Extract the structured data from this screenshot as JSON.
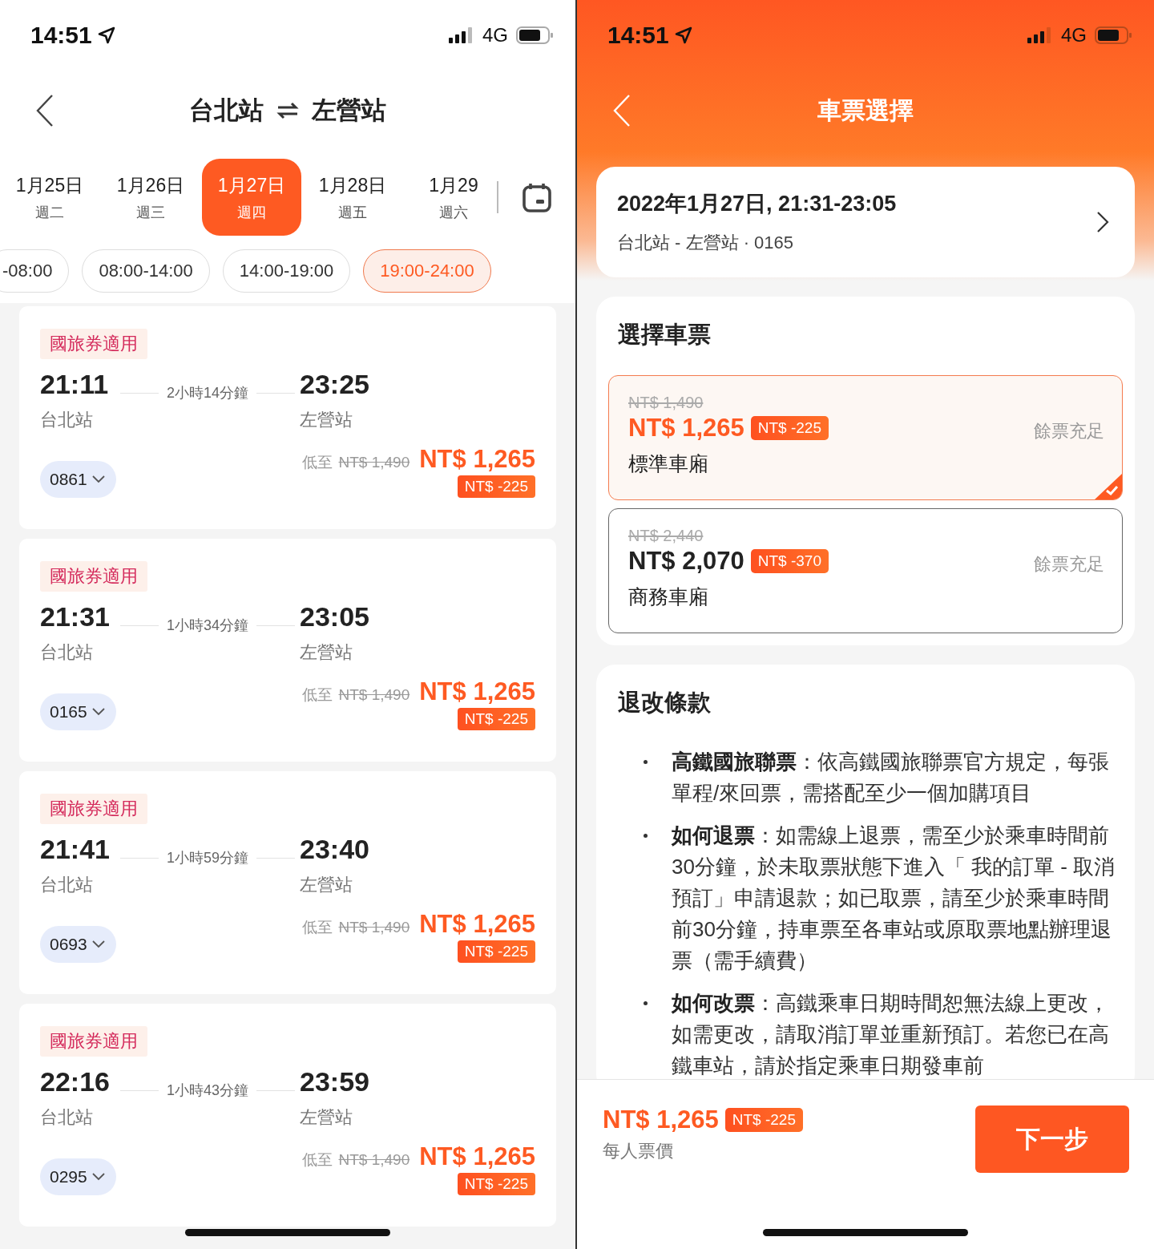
{
  "left": {
    "status": {
      "time": "14:51",
      "network": "4G"
    },
    "header": {
      "from": "台北站",
      "to": "左營站"
    },
    "dates": [
      {
        "date": "1月25日",
        "weekday": "週二",
        "selected": false
      },
      {
        "date": "1月26日",
        "weekday": "週三",
        "selected": false
      },
      {
        "date": "1月27日",
        "weekday": "週四",
        "selected": true
      },
      {
        "date": "1月28日",
        "weekday": "週五",
        "selected": false
      },
      {
        "date": "1月29",
        "weekday": "週六",
        "selected": false
      }
    ],
    "time_filters": [
      {
        "label": "-08:00",
        "selected": false
      },
      {
        "label": "08:00-14:00",
        "selected": false
      },
      {
        "label": "14:00-19:00",
        "selected": false
      },
      {
        "label": "19:00-24:00",
        "selected": true
      }
    ],
    "trains": [
      {
        "tag": "國旅券適用",
        "departure": "21:11",
        "duration": "2小時14分鐘",
        "arrival": "23:25",
        "from": "台北站",
        "to": "左營站",
        "number": "0861",
        "low_label": "低至",
        "original": "NT$ 1,490",
        "price": "NT$ 1,265",
        "discount": "NT$ -225"
      },
      {
        "tag": "國旅券適用",
        "departure": "21:31",
        "duration": "1小時34分鐘",
        "arrival": "23:05",
        "from": "台北站",
        "to": "左營站",
        "number": "0165",
        "low_label": "低至",
        "original": "NT$ 1,490",
        "price": "NT$ 1,265",
        "discount": "NT$ -225"
      },
      {
        "tag": "國旅券適用",
        "departure": "21:41",
        "duration": "1小時59分鐘",
        "arrival": "23:40",
        "from": "台北站",
        "to": "左營站",
        "number": "0693",
        "low_label": "低至",
        "original": "NT$ 1,490",
        "price": "NT$ 1,265",
        "discount": "NT$ -225"
      },
      {
        "tag": "國旅券適用",
        "departure": "22:16",
        "duration": "1小時43分鐘",
        "arrival": "23:59",
        "from": "台北站",
        "to": "左營站",
        "number": "0295",
        "low_label": "低至",
        "original": "NT$ 1,490",
        "price": "NT$ 1,265",
        "discount": "NT$ -225"
      }
    ]
  },
  "right": {
    "status": {
      "time": "14:51",
      "network": "4G"
    },
    "title": "車票選擇",
    "summary": {
      "datetime": "2022年1月27日, 21:31-23:05",
      "route": "台北站 - 左營站 · 0165"
    },
    "ticket_selection": {
      "heading": "選擇車票",
      "options": [
        {
          "original": "NT$ 1,490",
          "price": "NT$ 1,265",
          "discount": "NT$ -225",
          "class": "標準車廂",
          "availability": "餘票充足",
          "selected": true
        },
        {
          "original": "NT$ 2,440",
          "price": "NT$ 2,070",
          "discount": "NT$ -370",
          "class": "商務車廂",
          "availability": "餘票充足",
          "selected": false
        }
      ]
    },
    "policy": {
      "heading": "退改條款",
      "items": [
        "**高鐵國旅聯票**：依高鐵國旅聯票官方規定，每張單程/來回票，需搭配至少一個加購項目",
        "**如何退票**：如需線上退票，需至少於乘車時間前30分鐘，於未取票狀態下進入「 我的訂單 - 取消預訂」申請退款；如已取票，請至少於乘車時間前30分鐘，持車票至各車站或原取票地點辦理退票（需手續費）",
        "**如何改票**：高鐵乘車日期時間恕無法線上更改，如需更改，請取消訂單並重新預訂。若您已在高鐵車站，請於指定乘車日期發車前"
      ]
    },
    "footer": {
      "price": "NT$ 1,265",
      "discount": "NT$ -225",
      "note": "每人票價",
      "button": "下一步"
    }
  }
}
